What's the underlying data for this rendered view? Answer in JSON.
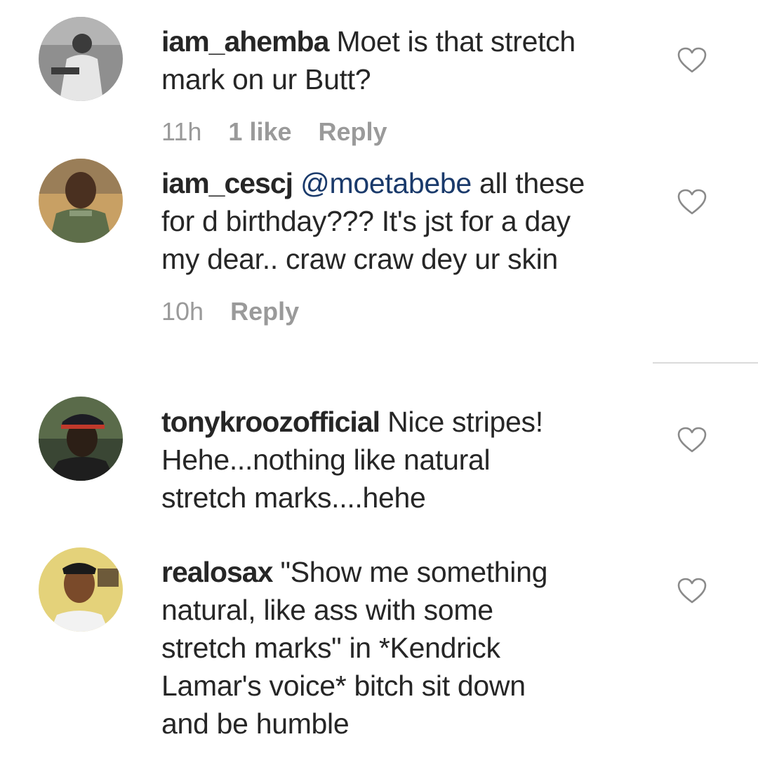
{
  "comments": [
    {
      "username": "iam_ahemba",
      "mention": "",
      "text_lines": [
        "Moet is that stretch",
        "mark on ur Butt?"
      ],
      "time": "11h",
      "likes": "1 like",
      "reply": "Reply",
      "avatar_colors": {
        "bg": "#8f8f8f",
        "fg": "#e6e6e6",
        "accent": "#3b3b3b"
      }
    },
    {
      "username": "iam_cescj",
      "mention": "@moetabebe",
      "text_lines": [
        "all these",
        "for d birthday??? It's jst for a day",
        "my dear.. craw craw dey ur skin"
      ],
      "time": "10h",
      "likes": "",
      "reply": "Reply",
      "avatar_colors": {
        "bg": "#c8a064",
        "fg": "#4a3020",
        "accent": "#5e6e4a"
      }
    },
    {
      "username": "tonykroozofficial",
      "mention": "",
      "text_lines": [
        "Nice stripes!",
        "Hehe...nothing like natural",
        "stretch marks....hehe"
      ],
      "time": "",
      "likes": "",
      "reply": "",
      "avatar_colors": {
        "bg": "#5a6b4a",
        "fg": "#2c1f16",
        "accent": "#c0392b"
      }
    },
    {
      "username": "realosax",
      "mention": "",
      "text_lines": [
        "\"Show me something",
        "natural, like ass with some",
        "stretch marks\" in *Kendrick",
        "Lamar's voice* bitch sit down",
        "and be humble"
      ],
      "time": "",
      "likes": "",
      "reply": "",
      "avatar_colors": {
        "bg": "#e4d27a",
        "fg": "#7a4a2a",
        "accent": "#f2f2f2"
      }
    }
  ],
  "icons": {
    "like": "heart-outline-icon"
  },
  "colors": {
    "text": "#262626",
    "meta": "#9a9a9a",
    "mention": "#1a3a6b",
    "divider": "#dbdbdb"
  }
}
